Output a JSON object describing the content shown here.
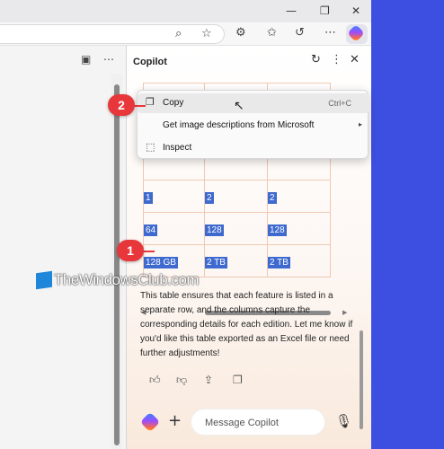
{
  "window": {
    "controls": [
      "—",
      "❐",
      "✕"
    ]
  },
  "toolbar": {
    "icons": [
      "zoom-icon",
      "favorite-star-icon",
      "extensions-icon",
      "favorites-icon",
      "history-icon",
      "more-icon",
      "copilot-icon"
    ]
  },
  "copilot": {
    "title": "Copilot"
  },
  "table": {
    "rows": [
      [
        "✓",
        "✓",
        "✓"
      ],
      [
        "",
        "",
        ""
      ],
      [
        "",
        "",
        ""
      ],
      [
        "1",
        "2",
        "2"
      ],
      [
        "64",
        "128",
        "128"
      ],
      [
        "128 GB",
        "2 TB",
        "2 TB"
      ]
    ]
  },
  "context_menu": {
    "items": [
      {
        "label": "Copy",
        "shortcut": "Ctrl+C"
      },
      {
        "label": "Get image descriptions from Microsoft",
        "submenu": "▸"
      },
      {
        "label": "Inspect"
      }
    ]
  },
  "message": {
    "text": "This table ensures that each feature is listed in a separate row, and the columns capture the corresponding details for each edition. Let me know if you'd like this table exported as an Excel file or need further adjustments!"
  },
  "composer": {
    "placeholder": "Message Copilot"
  },
  "markers": {
    "first": "1",
    "second": "2"
  },
  "watermark": {
    "text": "TheWindowsClub.com"
  },
  "colors": {
    "desktop": "#3d4fe0",
    "selection": "#3e69cf",
    "marker": "#e8373a",
    "table_border": "#efc9b3"
  }
}
